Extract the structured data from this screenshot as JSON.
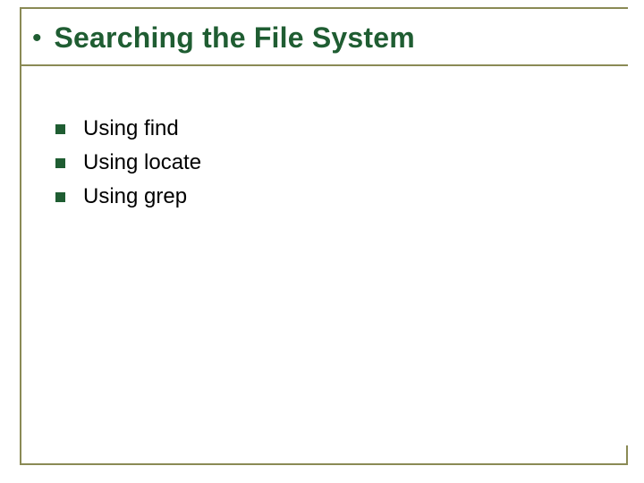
{
  "title": "Searching the File System",
  "items": [
    {
      "label": "Using find"
    },
    {
      "label": "Using locate"
    },
    {
      "label": "Using grep"
    }
  ]
}
